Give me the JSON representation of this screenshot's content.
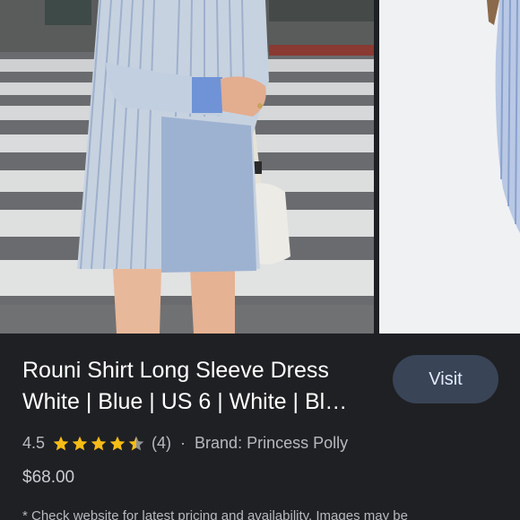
{
  "product": {
    "title_line1": "Rouni Shirt Long Sleeve Dress",
    "title_line2": "White | Blue | US 6 | White | Bl…",
    "rating": "4.5",
    "rating_value": 4.5,
    "review_count": "(4)",
    "separator": "·",
    "brand": "Brand: Princess Polly",
    "price": "$68.00",
    "disclaimer": "* Check website for latest pricing and availability. Images may be"
  },
  "actions": {
    "visit_label": "Visit"
  },
  "colors": {
    "background": "#1f2023",
    "button": "#394457",
    "button_text": "#e3ecff",
    "star": "#f6bc17"
  },
  "icons": {
    "star_full": "star-icon",
    "star_half": "star-half-icon"
  }
}
